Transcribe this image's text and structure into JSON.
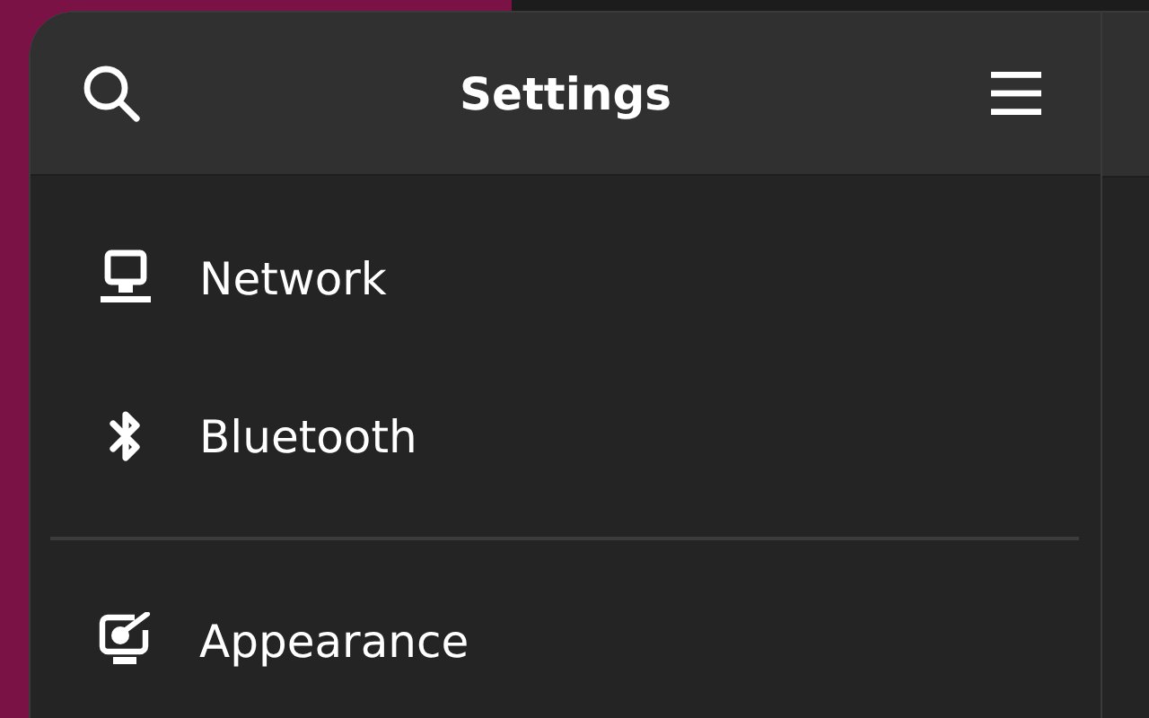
{
  "window": {
    "title": "Settings"
  },
  "sidebar": {
    "groups": [
      {
        "items": [
          {
            "label": "Network",
            "kind": "network"
          },
          {
            "label": "Bluetooth",
            "kind": "bluetooth"
          }
        ]
      },
      {
        "items": [
          {
            "label": "Appearance",
            "kind": "appearance"
          }
        ]
      }
    ]
  }
}
